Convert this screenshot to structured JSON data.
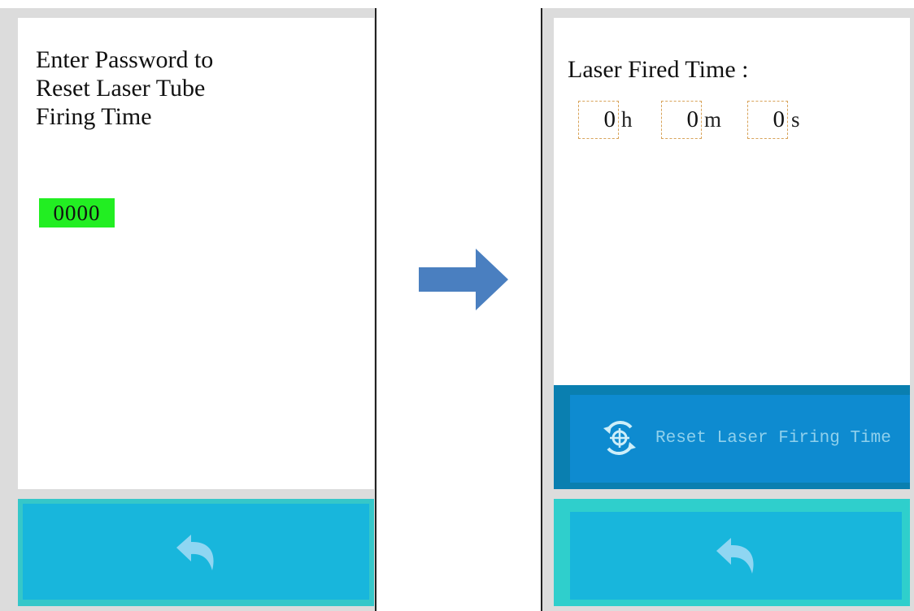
{
  "left_screen": {
    "prompt": "Enter Password to\nReset Laser Tube\nFiring  Time",
    "password_value": "0000",
    "back_icon": "back-arrow-icon"
  },
  "right_screen": {
    "title": "Laser Fired Time :",
    "hours": "0",
    "hours_unit": "h",
    "minutes": "0",
    "minutes_unit": "m",
    "seconds": "0",
    "seconds_unit": "s",
    "reset_label": "Reset Laser Firing Time",
    "reset_icon": "reset-target-icon",
    "back_icon": "back-arrow-icon"
  },
  "flow_icon": "right-arrow-icon",
  "colors": {
    "password_highlight": "#22ee22",
    "reset_bar": "#0a7fb0",
    "reset_button": "#0e8bd0",
    "back_bar": "#35c7c9",
    "back_button": "#18b6dc",
    "flow_arrow": "#4a7fc0"
  }
}
